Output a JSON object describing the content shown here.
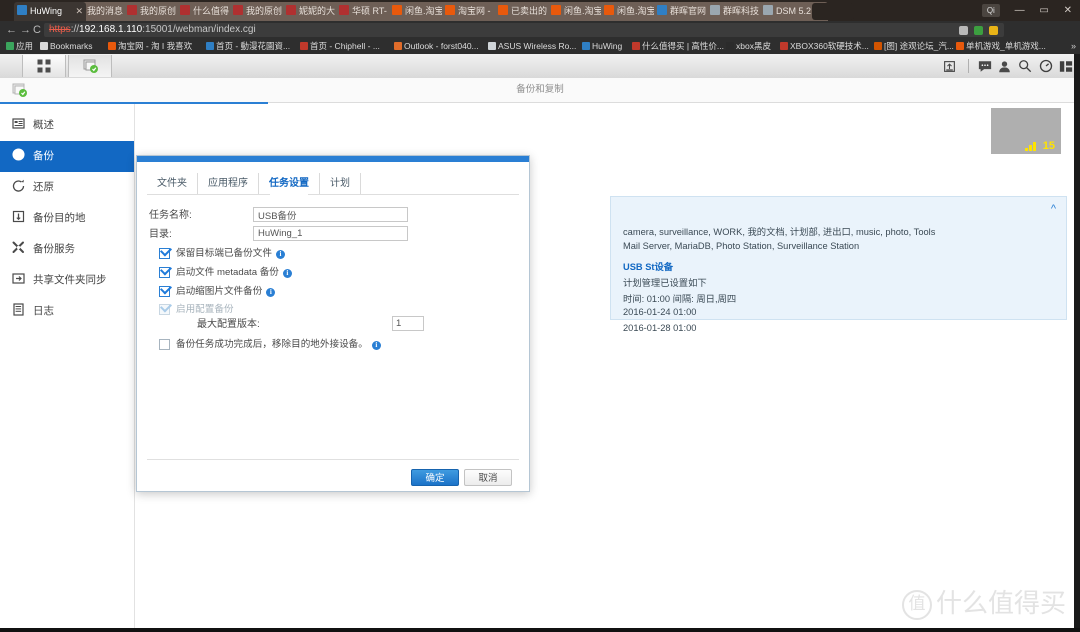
{
  "browser": {
    "tabs": [
      {
        "label": "HuWing",
        "active": true,
        "favicon": "#2f7fc4"
      },
      {
        "label": "我的消息 |",
        "active": false,
        "favicon": "#b03030"
      },
      {
        "label": "我的原创",
        "active": false,
        "favicon": "#b03030"
      },
      {
        "label": "什么值得",
        "active": false,
        "favicon": "#b03030"
      },
      {
        "label": "我的原创",
        "active": false,
        "favicon": "#b03030"
      },
      {
        "label": "妮妮的大",
        "active": false,
        "favicon": "#b03030"
      },
      {
        "label": "华硕 RT-",
        "active": false,
        "favicon": "#b03030"
      },
      {
        "label": "闲鱼.淘宝",
        "active": false,
        "favicon": "#e8590c"
      },
      {
        "label": "淘宝网 -",
        "active": false,
        "favicon": "#e8590c"
      },
      {
        "label": "已卖出的",
        "active": false,
        "favicon": "#e8590c"
      },
      {
        "label": "闲鱼.淘宝",
        "active": false,
        "favicon": "#e8590c"
      },
      {
        "label": "闲鱼.淘宝",
        "active": false,
        "favicon": "#e8590c"
      },
      {
        "label": "群晖官网",
        "active": false,
        "favicon": "#2f7fc4"
      },
      {
        "label": "群晖科技 |",
        "active": false,
        "favicon": "#9aa7b0"
      },
      {
        "label": "DSM 5.2",
        "active": false,
        "favicon": "#9aa7b0"
      }
    ],
    "window_controls": {
      "profile": "Qi",
      "minimize": "—",
      "maximize": "▭",
      "close": "✕"
    },
    "nav": {
      "back": "←",
      "forward": "→",
      "reload": "C"
    },
    "url": {
      "scheme": "https",
      "separator": "://",
      "host": "192.168.1.110",
      "port": ":15001",
      "path": "/webman/index.cgi"
    },
    "bookmarks": [
      {
        "label": "应用",
        "color": "#3ba55d"
      },
      {
        "label": "Bookmarks",
        "color": "#d8d8d8"
      },
      {
        "label": "淘宝网 - 淘 I 我喜欢",
        "color": "#e8590c"
      },
      {
        "label": "首页 - 動漫花園資...",
        "color": "#2f7fc4"
      },
      {
        "label": "首页 - Chiphell - ...",
        "color": "#c0392b"
      },
      {
        "label": "Outlook - forst040...",
        "color": "#e06c2a"
      },
      {
        "label": "ASUS Wireless Ro...",
        "color": "#cfd4d8"
      },
      {
        "label": "HuWing",
        "color": "#2f7fc4"
      },
      {
        "label": "什么值得买 | 高性价...",
        "color": "#c0392b"
      },
      {
        "label": "xbox黑皮",
        "color": "#2b2b2b"
      },
      {
        "label": "XBOX360软硬技术...",
        "color": "#c0392b"
      },
      {
        "label": "[图] 途观论坛_汽...",
        "color": "#d35400"
      },
      {
        "label": "单机游戏_单机游戏...",
        "color": "#e8590c"
      }
    ],
    "bookmark_overflow": "»"
  },
  "dsm": {
    "taskbar": {
      "apps_button": "apps-grid",
      "open_app_button": "backup-replication",
      "right_icons": [
        "upload-icon",
        "chat-icon",
        "user-icon",
        "search-icon",
        "notification-icon",
        "widgets-icon"
      ],
      "pilot_count": "15"
    },
    "window": {
      "title": "备份和复制",
      "sidebar": [
        {
          "label": "概述",
          "icon": "overview-icon",
          "active": false
        },
        {
          "label": "备份",
          "icon": "clock-icon",
          "active": true
        },
        {
          "label": "还原",
          "icon": "restore-icon",
          "active": false
        },
        {
          "label": "备份目的地",
          "icon": "destination-icon",
          "active": false
        },
        {
          "label": "备份服务",
          "icon": "wrench-icon",
          "active": false
        },
        {
          "label": "共享文件夹同步",
          "icon": "sync-icon",
          "active": false
        },
        {
          "label": "日志",
          "icon": "log-icon",
          "active": false
        }
      ],
      "info_card": {
        "collapse_icon": "^",
        "lines": [
          {
            "text": "camera, surveillance, WORK, 我的文档, 计划部, 进出口, music, photo, Tools",
            "bold": false
          },
          {
            "text": "Mail Server, MariaDB, Photo Station, Surveillance Station",
            "bold": false
          },
          {
            "text": "USB St设备",
            "bold": true
          },
          {
            "text": "计划管理已设置如下",
            "bold": false
          },
          {
            "text": "时间: 01:00 间隔: 周日,周四",
            "bold": false
          },
          {
            "text": "2016-01-24 01:00",
            "bold": false
          },
          {
            "text": "2016-01-28 01:00",
            "bold": false
          }
        ]
      }
    }
  },
  "dialog": {
    "tabs": [
      {
        "label": "文件夹",
        "active": false
      },
      {
        "label": "应用程序",
        "active": false
      },
      {
        "label": "任务设置",
        "active": true
      },
      {
        "label": "计划",
        "active": false
      }
    ],
    "fields": [
      {
        "label": "任务名称:",
        "value": "USB备份"
      },
      {
        "label": "目录:",
        "value": "HuWing_1"
      }
    ],
    "checkboxes": [
      {
        "label": "保留目标端已备份文件",
        "checked": true,
        "disabled": false,
        "info": true
      },
      {
        "label": "启动文件 metadata 备份",
        "checked": true,
        "disabled": false,
        "info": true
      },
      {
        "label": "启动缩图片文件备份",
        "checked": true,
        "disabled": false,
        "info": true
      },
      {
        "label": "启用配置备份",
        "checked": true,
        "disabled": true,
        "info": false
      }
    ],
    "version_field": {
      "label": "最大配置版本:",
      "value": "1"
    },
    "last_checkbox": {
      "label": "备份任务成功完成后，移除目的地外接设备。",
      "checked": false,
      "info": true
    },
    "buttons": {
      "ok": "确定",
      "cancel": "取消"
    },
    "info_glyph": "i"
  },
  "watermark": {
    "circle": "值",
    "text": "什么值得买"
  },
  "colors": {
    "accent": "#1268c3",
    "dialog_top": "#2a7fd4",
    "sidebar_active": "#1268c3",
    "info_card_bg": "#eaf3fb",
    "badge_yellow": "#ffe400"
  }
}
